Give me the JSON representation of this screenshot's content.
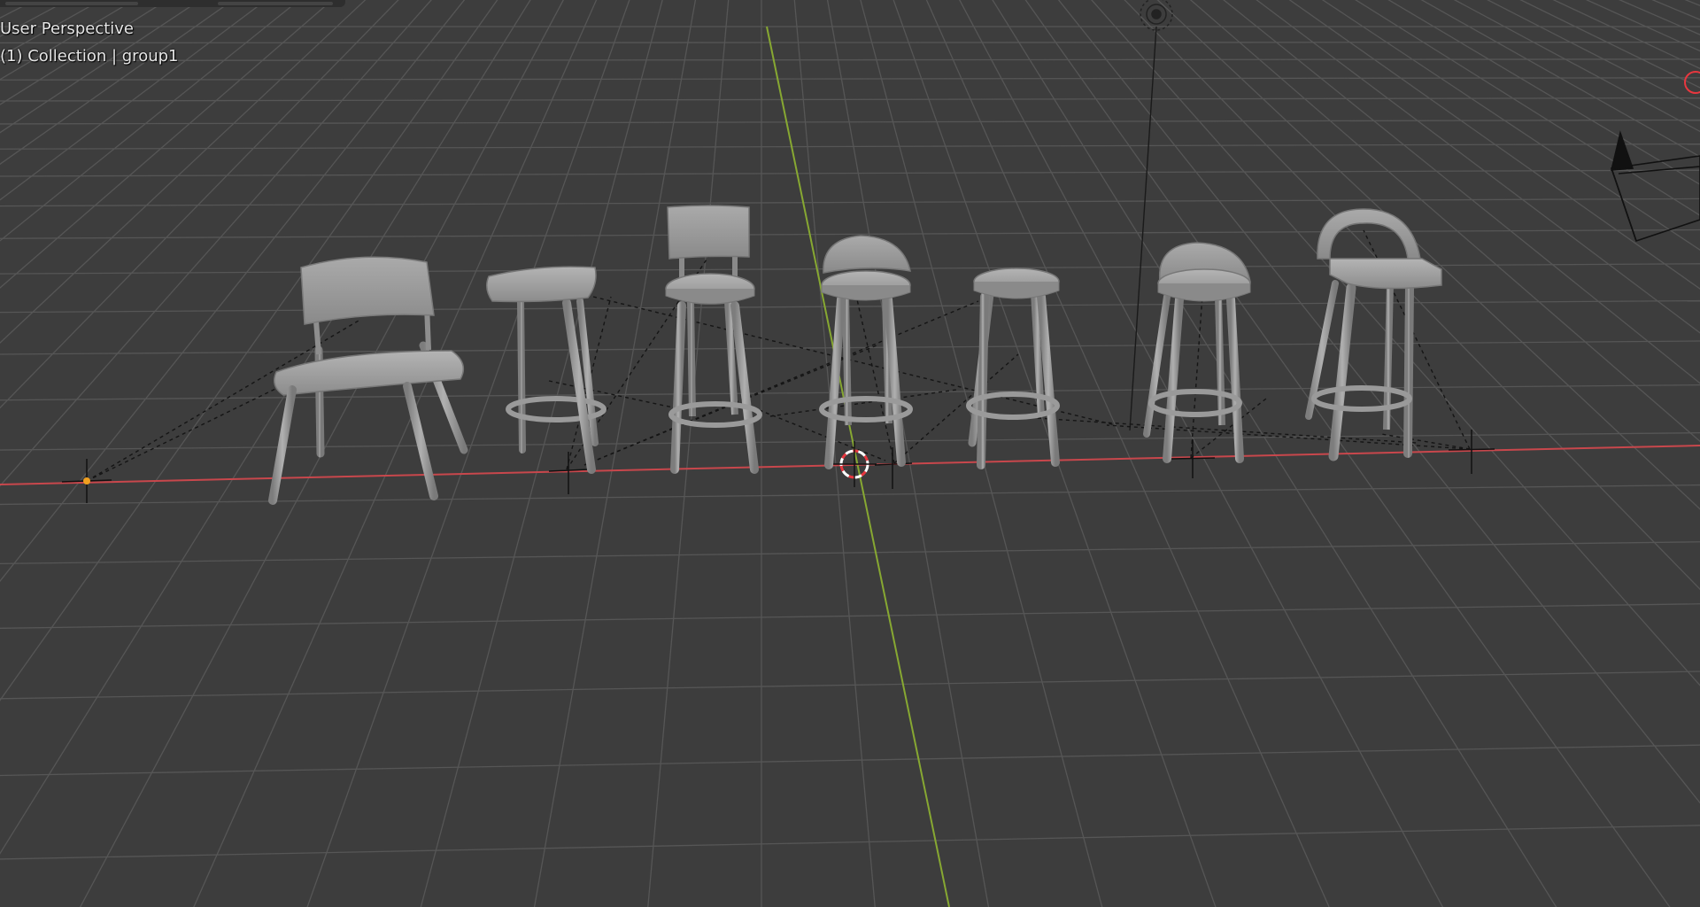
{
  "viewport": {
    "view_name": "User Perspective",
    "collection_info": "(1) Collection | group1"
  },
  "colors": {
    "background": "#3d3d3d",
    "grid_line": "#555555",
    "x_axis": "#c8474c",
    "y_axis": "#87a832",
    "model": "#9a9a9a",
    "camera_line": "#111111",
    "cursor_red": "#e8373f",
    "origin_dot": "#f0a020"
  },
  "objects": [
    {
      "name": "chair-dining",
      "type": "chair"
    },
    {
      "name": "stool-square",
      "type": "stool"
    },
    {
      "name": "stool-high-back",
      "type": "stool"
    },
    {
      "name": "stool-curved-back",
      "type": "stool"
    },
    {
      "name": "stool-round",
      "type": "stool"
    },
    {
      "name": "stool-low-back",
      "type": "stool"
    },
    {
      "name": "stool-hoop-back",
      "type": "stool"
    }
  ],
  "icons": [
    "3d-cursor-icon",
    "camera-icon",
    "light-icon",
    "empty-icon",
    "gizmo-x-icon"
  ]
}
